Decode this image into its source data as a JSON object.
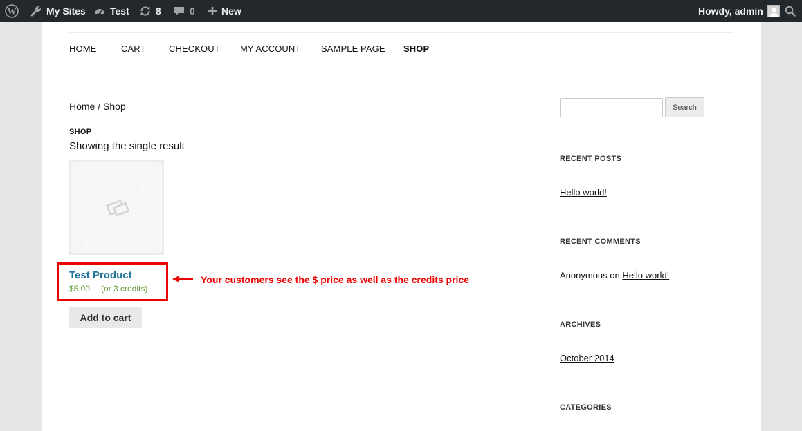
{
  "admin_bar": {
    "my_sites": "My Sites",
    "site_name": "Test",
    "updates_count": "8",
    "comments_count": "0",
    "new_label": "New",
    "greeting": "Howdy, admin"
  },
  "nav": {
    "items": [
      "HOME",
      "CART",
      "CHECKOUT",
      "MY ACCOUNT",
      "SAMPLE PAGE",
      "SHOP"
    ]
  },
  "breadcrumb": {
    "home": "Home",
    "separator": "/",
    "current": "Shop"
  },
  "shop": {
    "heading": "SHOP",
    "result_count": "Showing the single result"
  },
  "product": {
    "title": "Test Product",
    "price": "$5.00",
    "credits": "(or 3 credits)",
    "add_to_cart": "Add to cart"
  },
  "annotation": {
    "text": "Your customers see the $ price as well as the credits price",
    "color": "#ec0000"
  },
  "sidebar": {
    "search_button": "Search",
    "search_value": "",
    "recent_posts": {
      "title": "RECENT POSTS",
      "items": [
        "Hello world!"
      ]
    },
    "recent_comments": {
      "title": "RECENT COMMENTS",
      "author": "Anonymous",
      "connector": "on",
      "post": "Hello world!"
    },
    "archives": {
      "title": "ARCHIVES",
      "items": [
        "October 2014"
      ]
    },
    "categories": {
      "title": "CATEGORIES"
    }
  },
  "colors": {
    "admin_bar_bg": "#23282d",
    "product_link": "#21759b",
    "price": "#6b9a3a"
  }
}
